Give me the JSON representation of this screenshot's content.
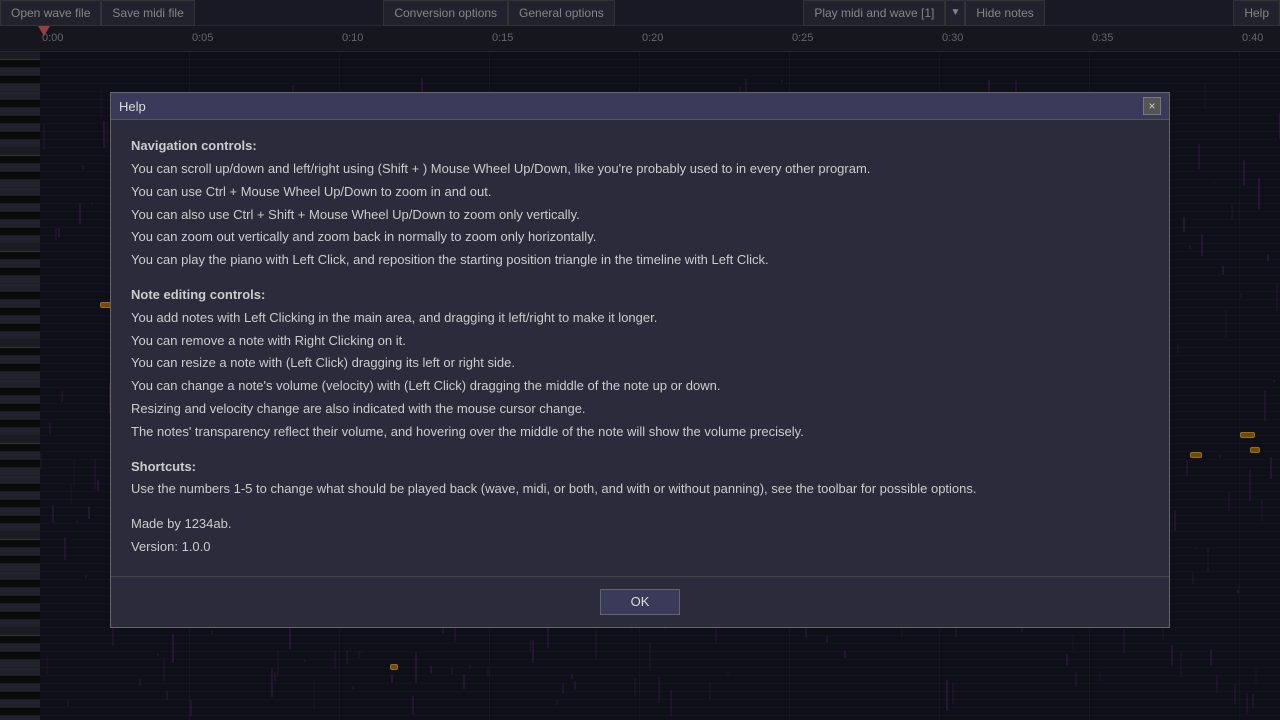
{
  "toolbar": {
    "open_wave_label": "Open wave file",
    "save_midi_label": "Save midi file",
    "conversion_label": "Conversion options",
    "general_label": "General options",
    "play_label": "Play midi and wave [1]",
    "hide_notes_label": "Hide notes",
    "help_label": "Help"
  },
  "timeline": {
    "markers": [
      "0:00",
      "0:05",
      "0:10",
      "0:15",
      "0:20",
      "0:25",
      "0:30",
      "0:35",
      "0:40"
    ]
  },
  "dialog": {
    "title": "Help",
    "close_label": "×",
    "nav_header": "Navigation controls:",
    "nav_line1": "You can scroll up/down and left/right using (Shift + ) Mouse Wheel Up/Down, like you're probably used to in every other program.",
    "nav_line2": "You can use Ctrl + Mouse Wheel Up/Down to zoom in and out.",
    "nav_line3": "You can also use Ctrl + Shift + Mouse Wheel Up/Down to zoom only vertically.",
    "nav_line4": "You can zoom out vertically and zoom back in normally to zoom only horizontally.",
    "nav_line5": "You can play the piano with Left Click, and reposition the starting position triangle in the timeline with Left Click.",
    "note_header": "Note editing controls:",
    "note_line1": "You add notes with Left Clicking in the main area, and dragging it left/right to make it longer.",
    "note_line2": "You can remove a note with Right Clicking on it.",
    "note_line3": "You can resize a note with (Left Click) dragging its left or right side.",
    "note_line4": "You can change a note's volume (velocity) with (Left Click) dragging the middle of the note up or down.",
    "note_line5": "Resizing and velocity change are also indicated with the mouse cursor change.",
    "note_line6": "The notes' transparency reflect their volume, and hovering over the middle of the note will show the volume precisely.",
    "shortcuts_header": "Shortcuts:",
    "shortcuts_line1": "Use the numbers 1-5 to change what should be played back (wave, midi, or both, and with or without panning), see the toolbar for possible options.",
    "made_by": "Made by 1234ab.",
    "version": "Version: 1.0.0",
    "ok_label": "OK"
  }
}
